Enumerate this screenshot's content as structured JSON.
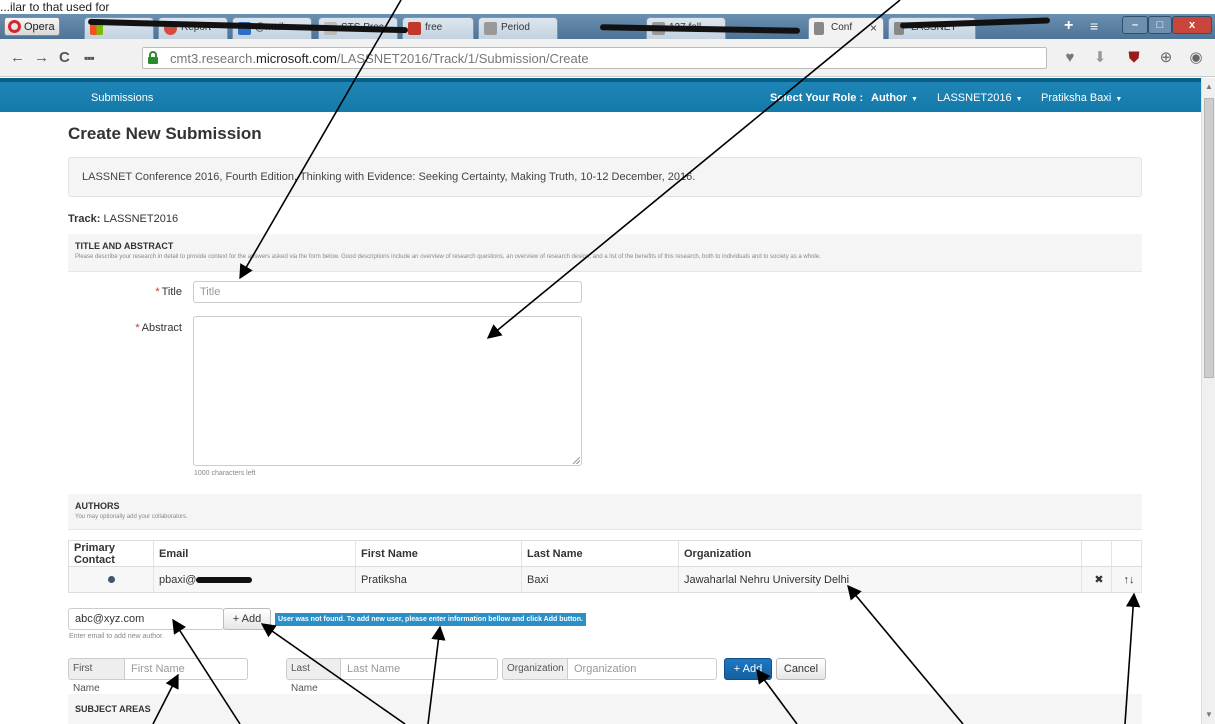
{
  "caption": "...ilar to that used for",
  "browser": {
    "opera_label": "Opera",
    "tabs": [
      {
        "label": ""
      },
      {
        "label": "Report"
      },
      {
        "label": "@mail"
      },
      {
        "label": "STS Proc"
      },
      {
        "label": "free"
      },
      {
        "label": "Period"
      },
      {
        "label": "127 foll"
      },
      {
        "label": "Conf",
        "active": true
      },
      {
        "label": "LASSNET"
      }
    ],
    "active_tab_close": "×",
    "new_tab": "+",
    "menu": "≡",
    "window_min": "–",
    "window_max": "□",
    "window_close": "x",
    "url_domain_pre": "cmt3.research.",
    "url_domain": "microsoft.com",
    "url_path": "/LASSNET2016/Track/1/Submission/Create"
  },
  "appbar": {
    "submissions": "Submissions",
    "role_label": "Select Your Role :",
    "role_value": "Author",
    "conference": "LASSNET2016",
    "user": "Pratiksha Baxi"
  },
  "page": {
    "title": "Create New Submission",
    "conference_info": "LASSNET Conference 2016, Fourth Edition, Thinking with Evidence: Seeking Certainty, Making Truth, 10-12 December, 2016.",
    "track_label": "Track:",
    "track_value": "LASSNET2016"
  },
  "title_abstract": {
    "heading": "TITLE AND ABSTRACT",
    "description": "Please describe your research in detail to provide context for the answers asked via the form below. Good descriptions include an overview of research questions, an overview of research design, and a list of the benefits of this research, both to individuals and to society as a whole.",
    "title_label": "Title",
    "title_placeholder": "Title",
    "abstract_label": "Abstract",
    "chars_left": "1000 characters left"
  },
  "authors": {
    "heading": "AUTHORS",
    "description": "You may optionally add your collaborators.",
    "columns": [
      "Primary Contact",
      "Email",
      "First Name",
      "Last Name",
      "Organization"
    ],
    "rows": [
      {
        "email": "pbaxi@",
        "first_name": "Pratiksha",
        "last_name": "Baxi",
        "organization": "Jawaharlal Nehru University Delhi"
      }
    ],
    "email_input_value": "abc@xyz.com",
    "add_label": "+ Add",
    "email_hint": "Enter email to add new author.",
    "not_found": "User was not found. To add new user, please enter information bellow and click Add button.",
    "first_name_addon": "First Name",
    "first_name_placeholder": "First Name",
    "last_name_addon": "Last Name",
    "last_name_placeholder": "Last Name",
    "organization_addon": "Organization",
    "organization_placeholder": "Organization",
    "add_primary_label": "+ Add",
    "cancel_label": "Cancel"
  },
  "subject_areas": {
    "heading": "SUBJECT AREAS"
  },
  "colors": {
    "appbar": "#1a80b1",
    "primary_button": "#1a6db4",
    "required": "#c0392b"
  }
}
